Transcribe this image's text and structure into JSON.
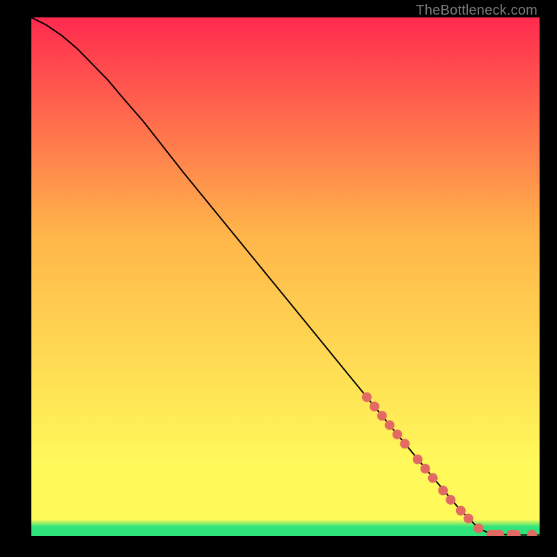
{
  "watermark": "TheBottleneck.com",
  "colors": {
    "marker": "#e36a63",
    "curve": "#000000",
    "green": "#2fe47a",
    "yellow_peak": "#fff95a",
    "orange_mid": "#ffb64a",
    "red_top": "#ff2a4f"
  },
  "chart_data": {
    "type": "line",
    "title": "",
    "xlabel": "",
    "ylabel": "",
    "xlim": [
      0,
      100
    ],
    "ylim": [
      0,
      100
    ],
    "curve": {
      "x": [
        0,
        3,
        6,
        9,
        12,
        15,
        18,
        22,
        30,
        40,
        50,
        60,
        70,
        78,
        84,
        88,
        90,
        91,
        93,
        95,
        97,
        100
      ],
      "y": [
        100,
        98.5,
        96.5,
        94,
        91,
        88,
        84.5,
        80,
        70,
        58,
        46,
        34,
        22,
        12.5,
        5.5,
        1.5,
        0.6,
        0.4,
        0.3,
        0.25,
        0.2,
        0.2
      ]
    },
    "series": [
      {
        "name": "markers",
        "x": [
          66,
          67.5,
          69,
          70.5,
          72,
          73.5,
          76,
          77.5,
          79,
          81,
          82.5,
          84.5,
          86,
          88,
          90.5,
          91.3,
          92.1,
          94.5,
          95.3,
          98.5
        ],
        "y": [
          26.8,
          25.0,
          23.2,
          21.4,
          19.6,
          17.8,
          14.8,
          13.0,
          11.2,
          8.8,
          7.0,
          4.9,
          3.4,
          1.5,
          0.3,
          0.3,
          0.3,
          0.3,
          0.3,
          0.3
        ]
      }
    ],
    "gradient_bands": [
      {
        "y0": 0.0,
        "y1": 1.8,
        "from": "green",
        "to": "green"
      },
      {
        "y0": 1.8,
        "y1": 3.2,
        "from": "green",
        "to": "yellow_peak"
      },
      {
        "y0": 3.2,
        "y1": 14,
        "from": "yellow_peak",
        "to": "yellow_peak"
      },
      {
        "y0": 14,
        "y1": 58,
        "from": "yellow_peak",
        "to": "orange_mid"
      },
      {
        "y0": 58,
        "y1": 100,
        "from": "orange_mid",
        "to": "red_top"
      }
    ]
  }
}
